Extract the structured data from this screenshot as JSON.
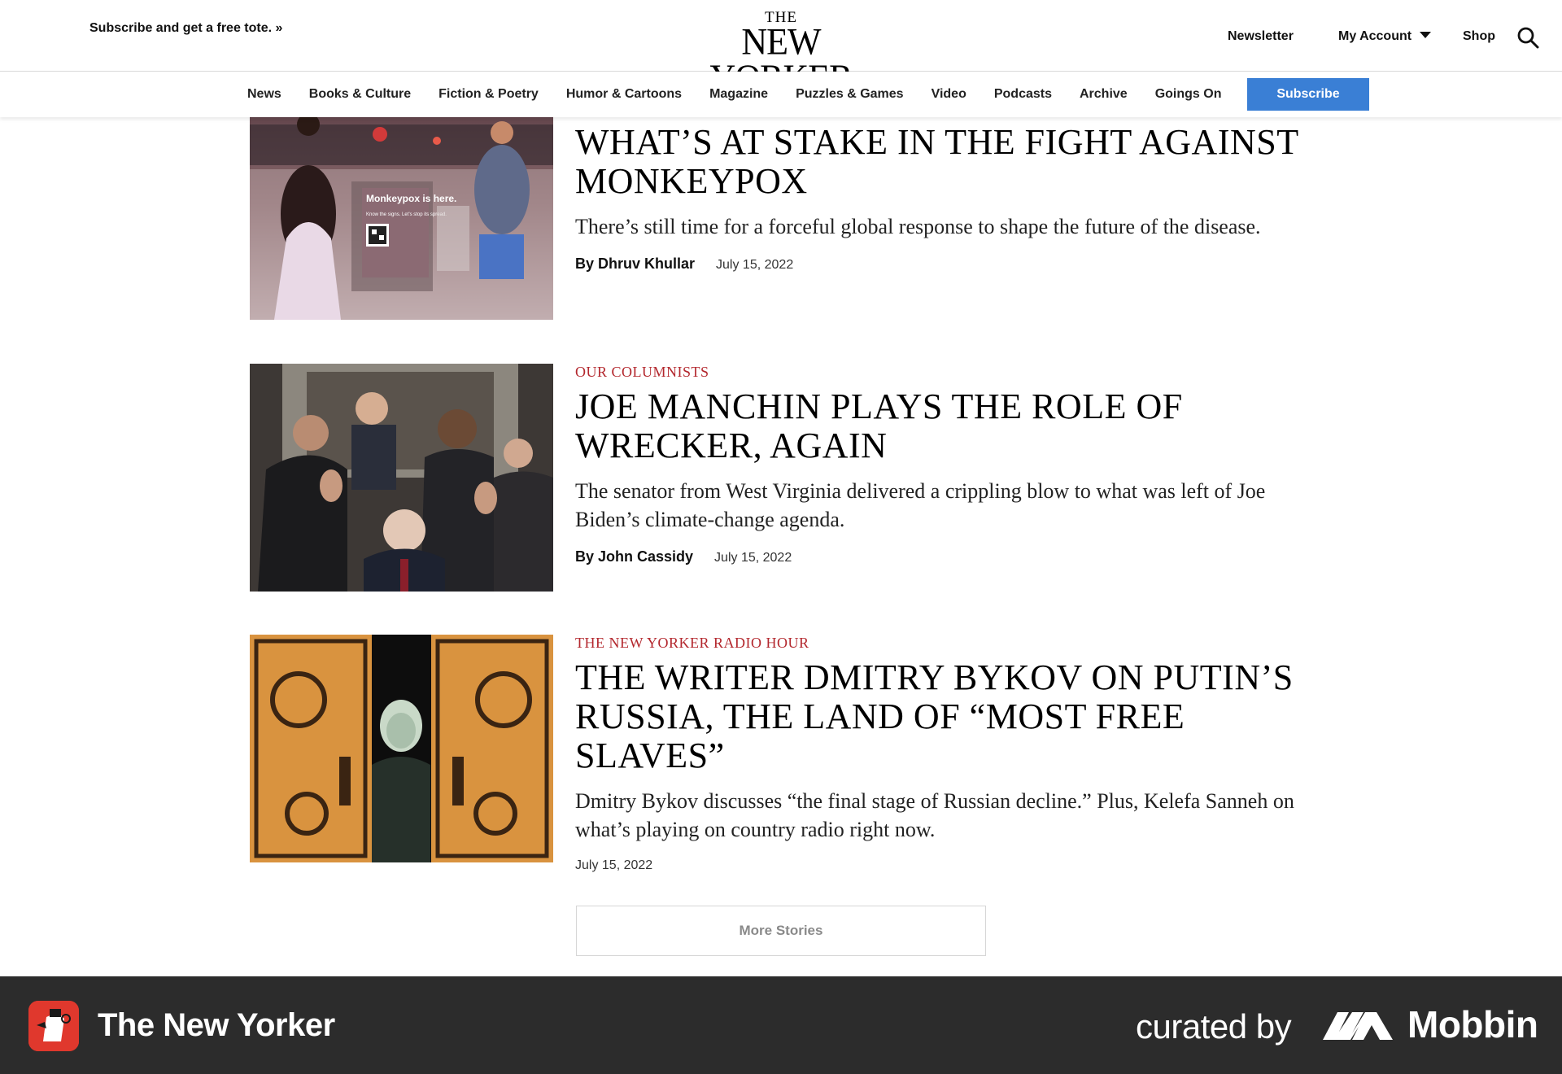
{
  "header": {
    "promo": "Subscribe and get a free tote. »",
    "logo_top": "THE",
    "logo_main": "NEW YORKER",
    "newsletter": "Newsletter",
    "account": "My Account",
    "shop": "Shop"
  },
  "nav": {
    "items": [
      "News",
      "Books & Culture",
      "Fiction & Poetry",
      "Humor & Cartoons",
      "Magazine",
      "Puzzles & Games",
      "Video",
      "Podcasts",
      "Archive",
      "Goings On"
    ],
    "subscribe": "Subscribe"
  },
  "articles": [
    {
      "headline": "What’s at Stake in the Fight Against Monkeypox",
      "dek": "There’s still time for a forceful global response to shape the future of the disease.",
      "byline": "By Dhruv Khullar",
      "date": "July 15, 2022",
      "image_sign": "Monkeypox is here.",
      "image_sign_small": "Know the signs. Let’s stop its spread."
    },
    {
      "rubric": "Our Columnists",
      "headline": "Joe Manchin Plays the Role of Wrecker, Again",
      "dek": "The senator from West Virginia delivered a crippling blow to what was left of Joe Biden’s climate-change agenda.",
      "byline": "By John Cassidy",
      "date": "July 15, 2022"
    },
    {
      "rubric": "The New Yorker Radio Hour",
      "headline": "The Writer Dmitry Bykov on Putin’s Russia, the Land of “Most Free Slaves”",
      "dek": "Dmitry Bykov discusses “the final stage of Russian decline.” Plus, Kelefa Sanneh on what’s playing on country radio right now.",
      "date": "July 15, 2022"
    }
  ],
  "more_stories": "More Stories",
  "footer": {
    "app_name": "The New Yorker",
    "curated_by": "curated by",
    "brand": "Mobbin"
  },
  "colors": {
    "subscribe_blue": "#3a7fd5",
    "rubric_red": "#b3272d",
    "footer_bg": "#2c2c2c",
    "app_icon_red": "#e0382d"
  }
}
